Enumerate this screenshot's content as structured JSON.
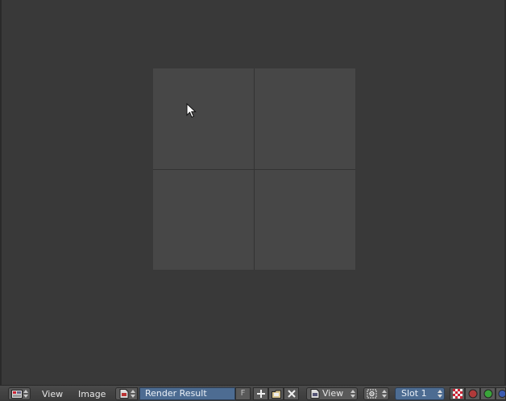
{
  "image_editor": {
    "canvas": {
      "tiles": 4
    }
  },
  "header": {
    "menu": {
      "view_label": "View",
      "image_label": "Image"
    },
    "image_datablock": {
      "name": "Render Result",
      "fake_user_label": "F"
    },
    "view_selector": {
      "label": "View"
    },
    "slot_selector": {
      "label": "Slot 1"
    },
    "icons": {
      "editor_type": "image-editor-icon",
      "browse": "image-browse-icon",
      "new": "plus-icon",
      "open": "folder-icon",
      "unlink": "close-icon",
      "view": "view-mode-icon",
      "pivot": "pivot-icon",
      "channels": [
        "checker-alpha-icon",
        "red-channel-icon",
        "green-channel-icon",
        "blue-channel-icon"
      ]
    },
    "colors": {
      "selected_field": "#4d6c92",
      "red_channel": "#b03a3a",
      "green_channel": "#3aa53a"
    }
  }
}
